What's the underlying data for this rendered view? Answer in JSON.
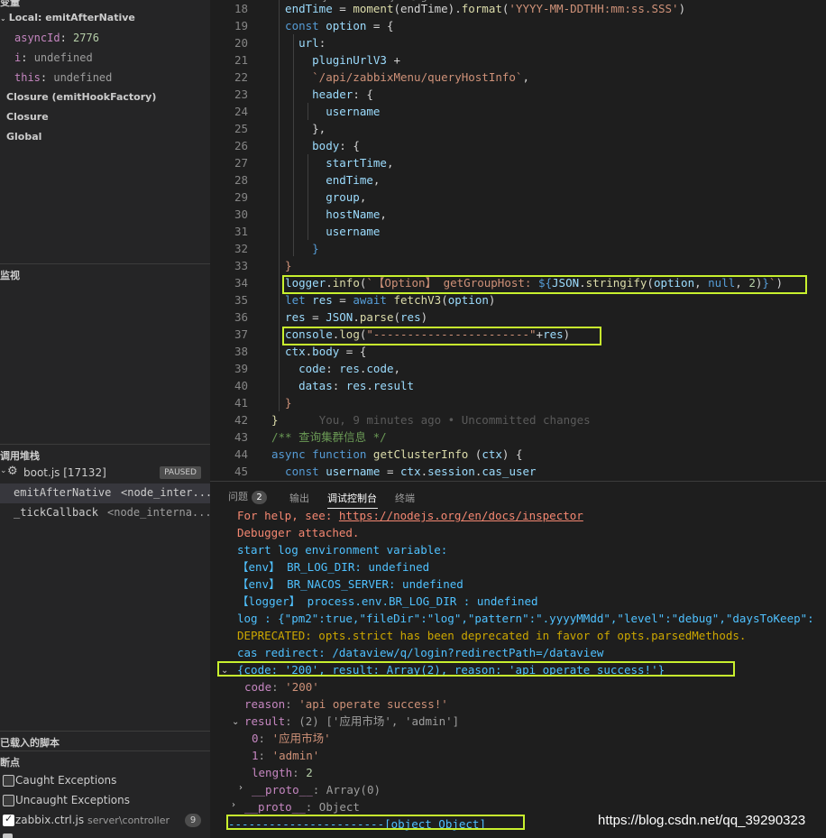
{
  "sidebar": {
    "variables": {
      "scope_local": "Local: emitAfterNative",
      "vars": [
        {
          "name": "asyncId",
          "sep": ": ",
          "value": "2776",
          "kind": "num"
        },
        {
          "name": "i",
          "sep": ": ",
          "value": "undefined",
          "kind": "undef"
        },
        {
          "name": "this",
          "sep": ": ",
          "value": "undefined",
          "kind": "undef"
        }
      ],
      "scope_closure_factory": "Closure (emitHookFactory)",
      "scope_closure": "Closure",
      "scope_global": "Global"
    },
    "watch_header": "监视",
    "callstack": {
      "header": "调用堆栈",
      "process": "boot.js [17132]",
      "paused_label": "PAUSED",
      "frames": [
        {
          "name": "emitAfterNative",
          "source": "<node_inter..."
        },
        {
          "name": "_tickCallback",
          "source": "<node_interna..."
        }
      ]
    },
    "loaded_scripts_header": "已载入的脚本",
    "breakpoints": {
      "header": "断点",
      "items": [
        {
          "label": "Caught Exceptions",
          "checked": false
        },
        {
          "label": "Uncaught Exceptions",
          "checked": false
        },
        {
          "label": "zabbix.ctrl.js",
          "path": "server\\controller",
          "count": "9",
          "checked": true
        }
      ]
    }
  },
  "editor": {
    "blame": "You, 9 minutes ago • Uncommitted changes"
  },
  "panel": {
    "tabs": [
      {
        "label": "问题",
        "count": "2"
      },
      {
        "label": "输出"
      },
      {
        "label": "调试控制台",
        "active": true
      },
      {
        "label": "终端"
      }
    ]
  },
  "console": {
    "help_text": "For help, see: ",
    "help_link": "https://nodejs.org/en/docs/inspector",
    "debugger_attached": "Debugger attached.",
    "start_log": "start log environment variable:",
    "env1": "【env】 BR_LOG_DIR: undefined",
    "env2": "【env】 BR_NACOS_SERVER: undefined",
    "logger_line": "【logger】 process.env.BR_LOG_DIR : undefined",
    "log_line": "log : {\"pm2\":true,\"fileDir\":\"log\",\"pattern\":\".yyyyMMdd\",\"level\":\"debug\",\"daysToKeep\":",
    "deprecated": "DEPRECATED: opts.strict has been deprecated in favor of opts.parsedMethods.",
    "cas_redirect": "cas redirect: /dataview/q/login?redirectPath=/dataview",
    "obj_summary": "{code: '200', result: Array(2), reason: 'api operate success!'}",
    "code_key": "code",
    "code_val": "'200'",
    "reason_key": "reason",
    "reason_val": "'api operate success!'",
    "result_key": "result",
    "result_summary": "(2) ['应用市场', 'admin']",
    "idx0": "0",
    "idx0_val": "'应用市场'",
    "idx1": "1",
    "idx1_val": "'admin'",
    "length_key": "length",
    "length_val": "2",
    "proto_key": "__proto__",
    "proto_arr": "Array(0)",
    "proto_obj": "Object",
    "last_line": "-----------------------[object Object]"
  },
  "watermark": "https://blog.csdn.net/qq_39290323"
}
